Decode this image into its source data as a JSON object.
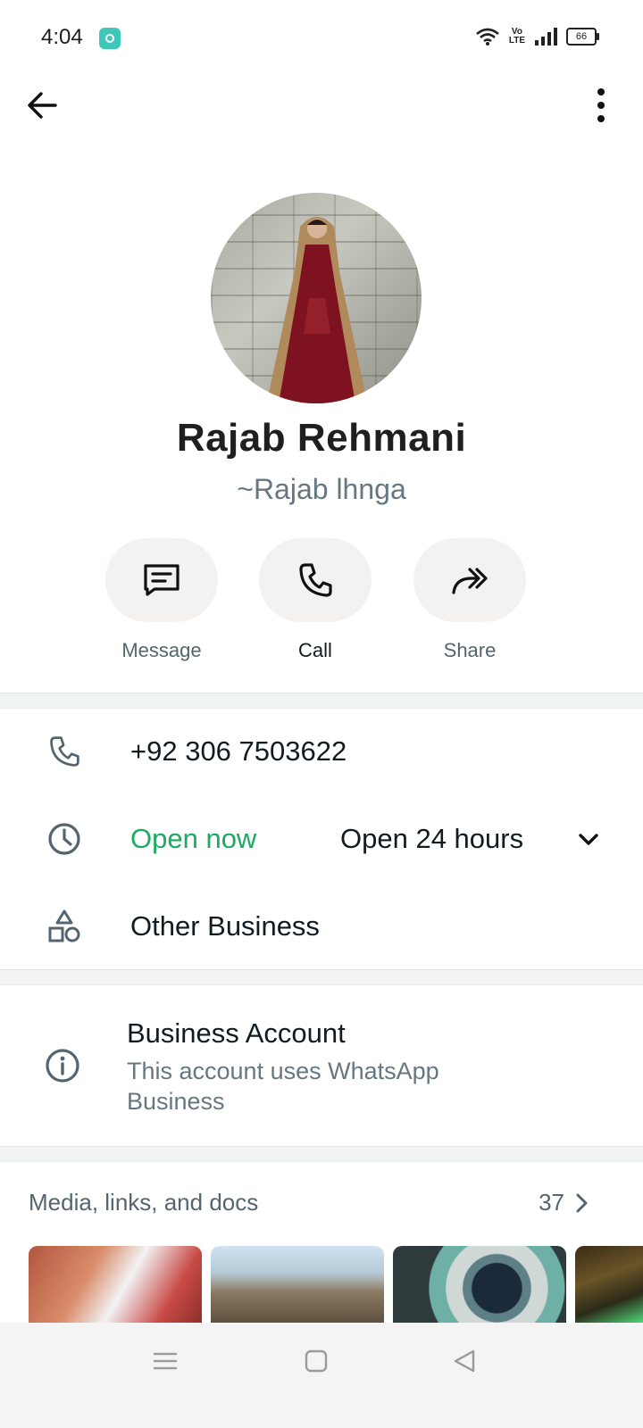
{
  "status_bar": {
    "time": "4:04",
    "network_label_top": "Vo",
    "network_label_bottom": "LTE",
    "battery": "66"
  },
  "contact": {
    "name": "Rajab Rehmani",
    "push_name": "~Rajab lhnga"
  },
  "actions": [
    {
      "label": "Message",
      "icon": "message-icon"
    },
    {
      "label": "Call",
      "icon": "phone-icon"
    },
    {
      "label": "Share",
      "icon": "share-icon"
    }
  ],
  "details": {
    "phone": "+92 306 7503622",
    "open_status": "Open now",
    "hours": "Open 24 hours",
    "category": "Other Business"
  },
  "business": {
    "title": "Business Account",
    "description": "This account uses WhatsApp Business"
  },
  "media": {
    "title": "Media, links, and docs",
    "count": "37"
  },
  "colors": {
    "open_green": "#1daa61",
    "secondary_text": "#667781",
    "action_bg": "#f3f2f0"
  }
}
